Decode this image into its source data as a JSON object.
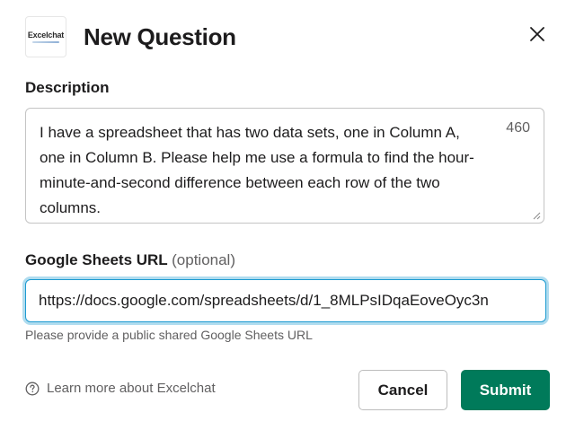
{
  "header": {
    "logo_text": "Excelchat",
    "title": "New Question",
    "close_icon": "close-icon"
  },
  "description": {
    "label": "Description",
    "value": "I have a spreadsheet that has two data sets, one in Column A, one in Column B. Please help me use a formula to find the hour-minute-and-second difference between each row of the two columns.",
    "char_count": "460"
  },
  "sheets_url": {
    "label": "Google Sheets URL",
    "optional": "(optional)",
    "value": "https://docs.google.com/spreadsheets/d/1_8MLPsIDqaEoveOyc3n",
    "hint": "Please provide a public shared Google Sheets URL"
  },
  "footer": {
    "learn_more": "Learn more about Excelchat",
    "cancel_label": "Cancel",
    "submit_label": "Submit"
  },
  "colors": {
    "submit_bg": "#007a5a",
    "focus_ring": "#1d9bd1",
    "text": "#1d1c1d",
    "muted": "#616061"
  }
}
